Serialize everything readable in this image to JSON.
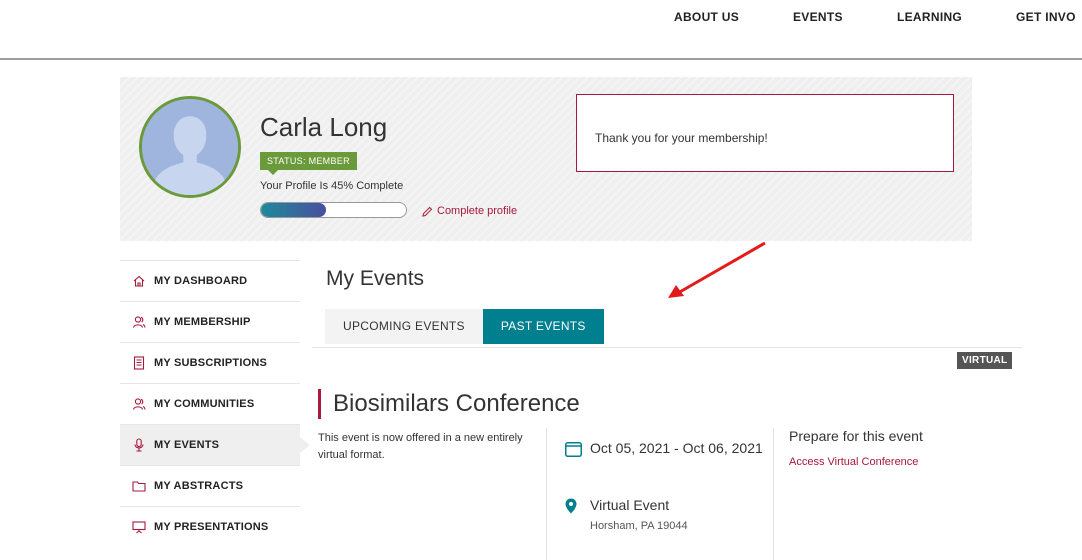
{
  "nav": {
    "items": [
      "ABOUT US",
      "EVENTS",
      "LEARNING",
      "GET INVO"
    ]
  },
  "profile": {
    "name": "Carla Long",
    "status": "STATUS: MEMBER",
    "completion_text": "Your Profile Is 45% Complete",
    "completion_fraction": 0.45,
    "complete_link": "Complete profile",
    "notice": "Thank you for your membership!"
  },
  "sidebar": {
    "items": [
      {
        "label": "MY DASHBOARD",
        "icon": "home-icon"
      },
      {
        "label": "MY MEMBERSHIP",
        "icon": "members-icon"
      },
      {
        "label": "MY SUBSCRIPTIONS",
        "icon": "document-icon"
      },
      {
        "label": "MY COMMUNITIES",
        "icon": "community-icon"
      },
      {
        "label": "MY EVENTS",
        "icon": "microphone-icon"
      },
      {
        "label": "MY ABSTRACTS",
        "icon": "folder-icon"
      },
      {
        "label": "MY PRESENTATIONS",
        "icon": "presentation-icon"
      }
    ],
    "active": "MY EVENTS"
  },
  "main": {
    "title": "My Events",
    "tabs": [
      {
        "label": "UPCOMING EVENTS",
        "active": false
      },
      {
        "label": "PAST EVENTS",
        "active": true
      }
    ]
  },
  "event": {
    "badge": "VIRTUAL",
    "title": "Biosimilars Conference",
    "description": "This event is now offered in a new entirely virtual format.",
    "dates": "Oct 05, 2021 - Oct 06, 2021",
    "location_name": "Virtual Event",
    "location_address": "Horsham, PA 19044",
    "prepare_heading": "Prepare for this event",
    "access_link": "Access Virtual Conference"
  },
  "colors": {
    "brand_red": "#a6193c",
    "teal": "#00808f",
    "status_green": "#6a9a3a",
    "annotation_arrow": "#e31b1b"
  }
}
